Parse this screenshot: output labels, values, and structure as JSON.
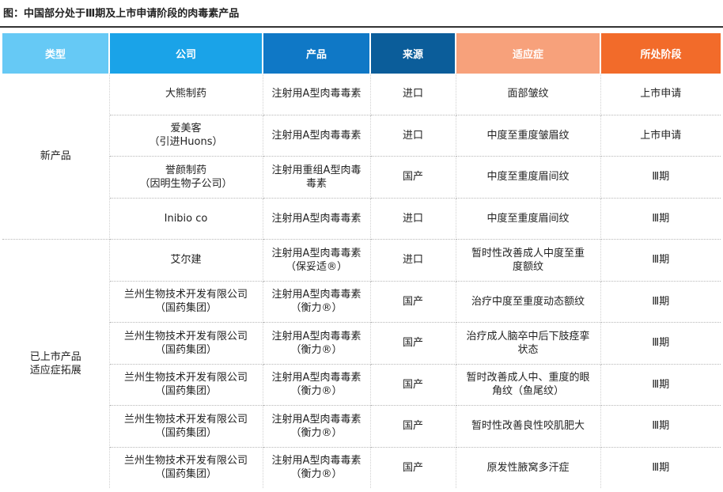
{
  "title": "图：中国部分处于Ⅲ期及上市申请阶段的肉毒素产品",
  "colors": {
    "header_type": "#66c9f5",
    "header_company": "#1aa3e8",
    "header_product": "#0f78c6",
    "header_source": "#0b5d9a",
    "header_indication": "#f7a17b",
    "header_stage": "#f26b2a"
  },
  "headers": {
    "type": "类型",
    "company": "公司",
    "product": "产品",
    "source": "来源",
    "indication": "适应症",
    "stage": "所处阶段"
  },
  "groups": {
    "new": "新产品",
    "expansion": "已上市产品\n适应症拓展"
  },
  "rows": [
    {
      "company": "大熊制药",
      "product": "注射用A型肉毒毒素",
      "source": "进口",
      "indication": "面部皱纹",
      "stage": "上市申请"
    },
    {
      "company": "爱美客\n（引进Huons）",
      "product": "注射用A型肉毒毒素",
      "source": "进口",
      "indication": "中度至重度皱眉纹",
      "stage": "上市申请"
    },
    {
      "company": "誉颜制药\n（因明生物子公司）",
      "product": "注射用重组A型肉毒\n毒素",
      "source": "国产",
      "indication": "中度至重度眉间纹",
      "stage": "Ⅲ期"
    },
    {
      "company": "Inibio co",
      "product": "注射用A型肉毒毒素",
      "source": "进口",
      "indication": "中度至重度眉间纹",
      "stage": "Ⅲ期"
    },
    {
      "company": "艾尔建",
      "product": "注射用A型肉毒毒素\n（保妥适®）",
      "source": "进口",
      "indication": "暂时性改善成人中度至重\n度额纹",
      "stage": "Ⅲ期"
    },
    {
      "company": "兰州生物技术开发有限公司\n（国药集团）",
      "product": "注射用A型肉毒毒素\n（衡力®）",
      "source": "国产",
      "indication": "治疗中度至重度动态额纹",
      "stage": "Ⅲ期"
    },
    {
      "company": "兰州生物技术开发有限公司\n（国药集团）",
      "product": "注射用A型肉毒毒素\n（衡力®）",
      "source": "国产",
      "indication": "治疗成人脑卒中后下肢痉挛\n状态",
      "stage": "Ⅲ期"
    },
    {
      "company": "兰州生物技术开发有限公司\n（国药集团）",
      "product": "注射用A型肉毒毒素\n（衡力®）",
      "source": "国产",
      "indication": "暂时改善成人中、重度的眼\n角纹（鱼尾纹）",
      "stage": "Ⅲ期"
    },
    {
      "company": "兰州生物技术开发有限公司\n（国药集团）",
      "product": "注射用A型肉毒毒素\n（衡力®）",
      "source": "国产",
      "indication": "暂时性改善良性咬肌肥大",
      "stage": "Ⅲ期"
    },
    {
      "company": "兰州生物技术开发有限公司\n（国药集团）",
      "product": "注射用A型肉毒毒素\n（衡力®）",
      "source": "国产",
      "indication": "原发性腋窝多汗症",
      "stage": "Ⅲ期"
    }
  ]
}
